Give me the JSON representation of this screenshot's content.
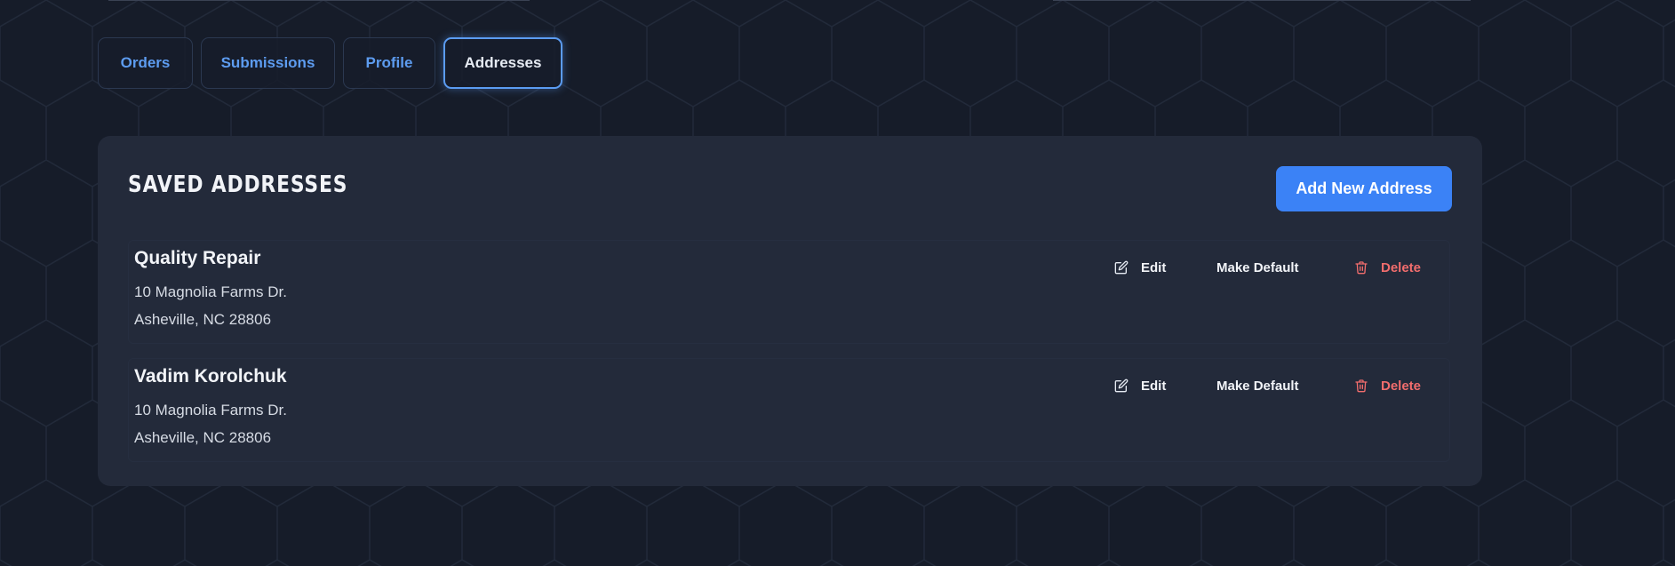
{
  "tabs": [
    {
      "label": "Orders",
      "active": false
    },
    {
      "label": "Submissions",
      "active": false
    },
    {
      "label": "Profile",
      "active": false
    },
    {
      "label": "Addresses",
      "active": true
    }
  ],
  "card": {
    "title": "SAVED ADDRESSES",
    "add_button_label": "Add New Address"
  },
  "addresses": [
    {
      "name": "Quality Repair",
      "line1": "10 Magnolia Farms Dr.",
      "line2": "Asheville, NC 28806",
      "edit_label": "Edit",
      "default_label": "Make Default",
      "delete_label": "Delete"
    },
    {
      "name": "Vadim Korolchuk",
      "line1": "10 Magnolia Farms Dr.",
      "line2": "Asheville, NC 28806",
      "edit_label": "Edit",
      "default_label": "Make Default",
      "delete_label": "Delete"
    }
  ],
  "icons": {
    "edit": "edit-icon",
    "delete": "trash-icon"
  },
  "colors": {
    "background": "#161c29",
    "card": "#232a3a",
    "accent": "#3b82f6",
    "tab_text": "#5d9cf0",
    "danger": "#f26d6d"
  }
}
